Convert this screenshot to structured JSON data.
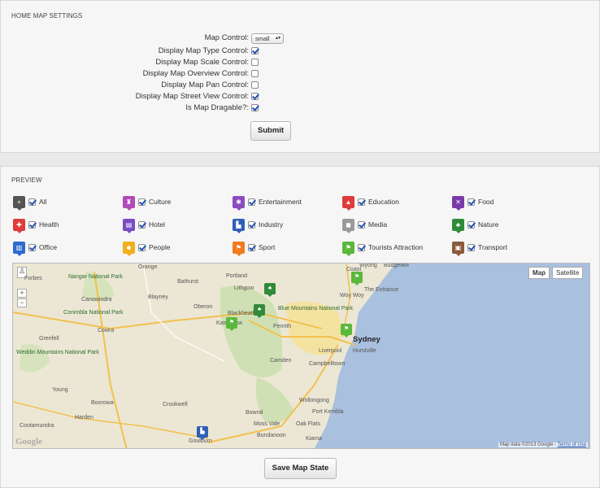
{
  "settings": {
    "title": "HOME MAP SETTINGS",
    "map_control_label": "Map Control:",
    "map_control_value": "small",
    "options": [
      {
        "label": "Display Map Type Control:",
        "checked": true
      },
      {
        "label": "Display Map Scale Control:",
        "checked": false
      },
      {
        "label": "Display Map Overview Control:",
        "checked": false
      },
      {
        "label": "Display Map Pan Control:",
        "checked": false
      },
      {
        "label": "Display Map Street View Control:",
        "checked": true
      },
      {
        "label": "Is Map Dragable?:",
        "checked": true
      }
    ],
    "submit_label": "Submit"
  },
  "preview": {
    "title": "PREVIEW",
    "categories": [
      {
        "name": "All",
        "icon": "plus-icon",
        "color": "#555555",
        "glyph": "+",
        "checked": true
      },
      {
        "name": "Culture",
        "icon": "culture-icon",
        "color": "#b24ab8",
        "glyph": "♜",
        "checked": true
      },
      {
        "name": "Entertainment",
        "icon": "entertainment-icon",
        "color": "#8a4cc0",
        "glyph": "✱",
        "checked": true
      },
      {
        "name": "Education",
        "icon": "graduation-cap-icon",
        "color": "#e03a3a",
        "glyph": "▲",
        "checked": true
      },
      {
        "name": "Food",
        "icon": "fork-knife-icon",
        "color": "#7a3aa8",
        "glyph": "✕",
        "checked": true
      },
      {
        "name": "Health",
        "icon": "health-icon",
        "color": "#e03a3a",
        "glyph": "✚",
        "checked": true
      },
      {
        "name": "Hotel",
        "icon": "hotel-icon",
        "color": "#7a4cc0",
        "glyph": "▤",
        "checked": true
      },
      {
        "name": "Industry",
        "icon": "factory-icon",
        "color": "#2f5fb8",
        "glyph": "▙",
        "checked": true
      },
      {
        "name": "Media",
        "icon": "camera-icon",
        "color": "#9a9a9a",
        "glyph": "◼",
        "checked": true
      },
      {
        "name": "Nature",
        "icon": "tree-icon",
        "color": "#2f8a3a",
        "glyph": "♣",
        "checked": true
      },
      {
        "name": "Office",
        "icon": "office-building-icon",
        "color": "#2f6ad0",
        "glyph": "▥",
        "checked": true
      },
      {
        "name": "People",
        "icon": "people-icon",
        "color": "#f0b020",
        "glyph": "☻",
        "checked": true
      },
      {
        "name": "Sport",
        "icon": "sport-icon",
        "color": "#f07a20",
        "glyph": "⚑",
        "checked": true
      },
      {
        "name": "Tourists Attraction",
        "icon": "flag-icon",
        "color": "#5ab83a",
        "glyph": "⚑",
        "checked": true
      },
      {
        "name": "Transport",
        "icon": "bus-icon",
        "color": "#8a5a3a",
        "glyph": "▣",
        "checked": true
      }
    ],
    "map": {
      "type_buttons": [
        "Map",
        "Satellite"
      ],
      "active_type": "Map",
      "zoom_in": "+",
      "zoom_out": "−",
      "places": [
        {
          "name": "Orange",
          "cls": ""
        },
        {
          "name": "Bathurst",
          "cls": ""
        },
        {
          "name": "Portland",
          "cls": ""
        },
        {
          "name": "Lithgow",
          "cls": ""
        },
        {
          "name": "Coast",
          "cls": ""
        },
        {
          "name": "Wyong",
          "cls": ""
        },
        {
          "name": "Budgewoi",
          "cls": ""
        },
        {
          "name": "The Entrance",
          "cls": ""
        },
        {
          "name": "Woy Woy",
          "cls": ""
        },
        {
          "name": "Nangar National Park",
          "cls": "park"
        },
        {
          "name": "Canowindra",
          "cls": ""
        },
        {
          "name": "Blayney",
          "cls": ""
        },
        {
          "name": "Oberon",
          "cls": ""
        },
        {
          "name": "Blackheath",
          "cls": ""
        },
        {
          "name": "Blue Mountains National Park",
          "cls": "park"
        },
        {
          "name": "Katoomba",
          "cls": ""
        },
        {
          "name": "Penrith",
          "cls": ""
        },
        {
          "name": "Sydney",
          "cls": "big"
        },
        {
          "name": "Conimbla National Park",
          "cls": "park"
        },
        {
          "name": "Cowra",
          "cls": ""
        },
        {
          "name": "Grenfell",
          "cls": ""
        },
        {
          "name": "Weddin Mountains National Park",
          "cls": "park"
        },
        {
          "name": "Camden",
          "cls": ""
        },
        {
          "name": "Liverpool",
          "cls": ""
        },
        {
          "name": "Hurstville",
          "cls": ""
        },
        {
          "name": "Campbelltown",
          "cls": ""
        },
        {
          "name": "Young",
          "cls": ""
        },
        {
          "name": "Boorowa",
          "cls": ""
        },
        {
          "name": "Crookwell",
          "cls": ""
        },
        {
          "name": "Wollongong",
          "cls": ""
        },
        {
          "name": "Port Kembla",
          "cls": ""
        },
        {
          "name": "Bowral",
          "cls": ""
        },
        {
          "name": "Moss Vale",
          "cls": ""
        },
        {
          "name": "Oak Flats",
          "cls": ""
        },
        {
          "name": "Harden",
          "cls": ""
        },
        {
          "name": "Cootamundra",
          "cls": ""
        },
        {
          "name": "Goulburn",
          "cls": ""
        },
        {
          "name": "Kiama",
          "cls": ""
        },
        {
          "name": "Forbes",
          "cls": ""
        },
        {
          "name": "Bundanoon",
          "cls": ""
        }
      ],
      "attribution": "Map data ©2013 Google - ",
      "terms_label": "Terms of Use",
      "logo": "Google"
    },
    "save_label": "Save Map State"
  }
}
